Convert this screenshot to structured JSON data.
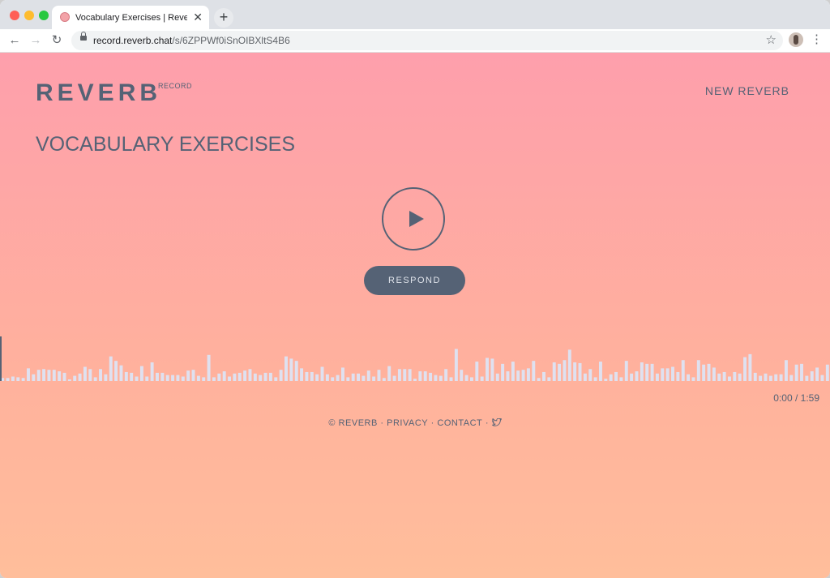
{
  "browser": {
    "tab_title": "Vocabulary Exercises | Reverb Re",
    "url_host": "record.reverb.chat",
    "url_path": "/s/6ZPPWf0iSnOIBXltS4B6"
  },
  "header": {
    "logo": "REVERB",
    "logo_sub": "RECORD",
    "new_reverb": "NEW REVERB"
  },
  "main": {
    "title": "VOCABULARY EXERCISES",
    "respond_label": "RESPOND",
    "time": "0:00 / 1:59",
    "progress": 0
  },
  "waveform": {
    "color": "#dfe1f0",
    "levels": [
      0.08,
      0.08,
      0.12,
      0.1,
      0.08,
      0.34,
      0.18,
      0.3,
      0.32,
      0.3,
      0.3,
      0.26,
      0.22,
      0.04,
      0.14,
      0.2,
      0.38,
      0.32,
      0.1,
      0.32,
      0.18,
      0.66,
      0.54,
      0.42,
      0.24,
      0.22,
      0.12,
      0.4,
      0.12,
      0.5,
      0.22,
      0.22,
      0.16,
      0.16,
      0.16,
      0.12,
      0.28,
      0.3,
      0.14,
      0.1,
      0.7,
      0.1,
      0.2,
      0.26,
      0.12,
      0.2,
      0.22,
      0.28,
      0.32,
      0.2,
      0.16,
      0.22,
      0.22,
      0.1,
      0.3,
      0.66,
      0.6,
      0.54,
      0.34,
      0.24,
      0.24,
      0.18,
      0.38,
      0.18,
      0.1,
      0.16,
      0.36,
      0.1,
      0.2,
      0.2,
      0.14,
      0.28,
      0.12,
      0.3,
      0.08,
      0.4,
      0.14,
      0.32,
      0.32,
      0.32,
      0.06,
      0.26,
      0.26,
      0.22,
      0.16,
      0.14,
      0.32,
      0.1,
      0.86,
      0.3,
      0.16,
      0.1,
      0.52,
      0.12,
      0.62,
      0.6,
      0.2,
      0.46,
      0.26,
      0.52,
      0.28,
      0.3,
      0.34,
      0.54,
      0.08,
      0.24,
      0.1,
      0.5,
      0.46,
      0.56,
      0.84,
      0.5,
      0.48,
      0.2,
      0.32,
      0.1,
      0.52,
      0.06,
      0.18,
      0.24,
      0.1,
      0.54,
      0.2,
      0.26,
      0.5,
      0.46,
      0.46,
      0.2,
      0.34,
      0.34,
      0.38,
      0.24,
      0.56,
      0.18,
      0.1,
      0.56,
      0.44,
      0.46,
      0.36,
      0.2,
      0.24,
      0.12,
      0.24,
      0.2,
      0.64,
      0.72,
      0.22,
      0.14,
      0.2,
      0.14,
      0.18,
      0.18,
      0.56,
      0.16,
      0.44,
      0.46,
      0.14,
      0.26,
      0.36,
      0.16,
      0.44
    ]
  },
  "footer": {
    "copyright": "© REVERB",
    "sep1": "·",
    "privacy": "PRIVACY",
    "sep2": "·",
    "contact": "CONTACT",
    "sep3": "·"
  },
  "colors": {
    "ink": "#556275",
    "gradient_top": "#fe9fac",
    "gradient_bottom": "#ffbe9b"
  },
  "icons": {
    "play": "play-icon",
    "twitter": "twitter-icon",
    "star": "star-icon",
    "lock": "lock-icon"
  }
}
